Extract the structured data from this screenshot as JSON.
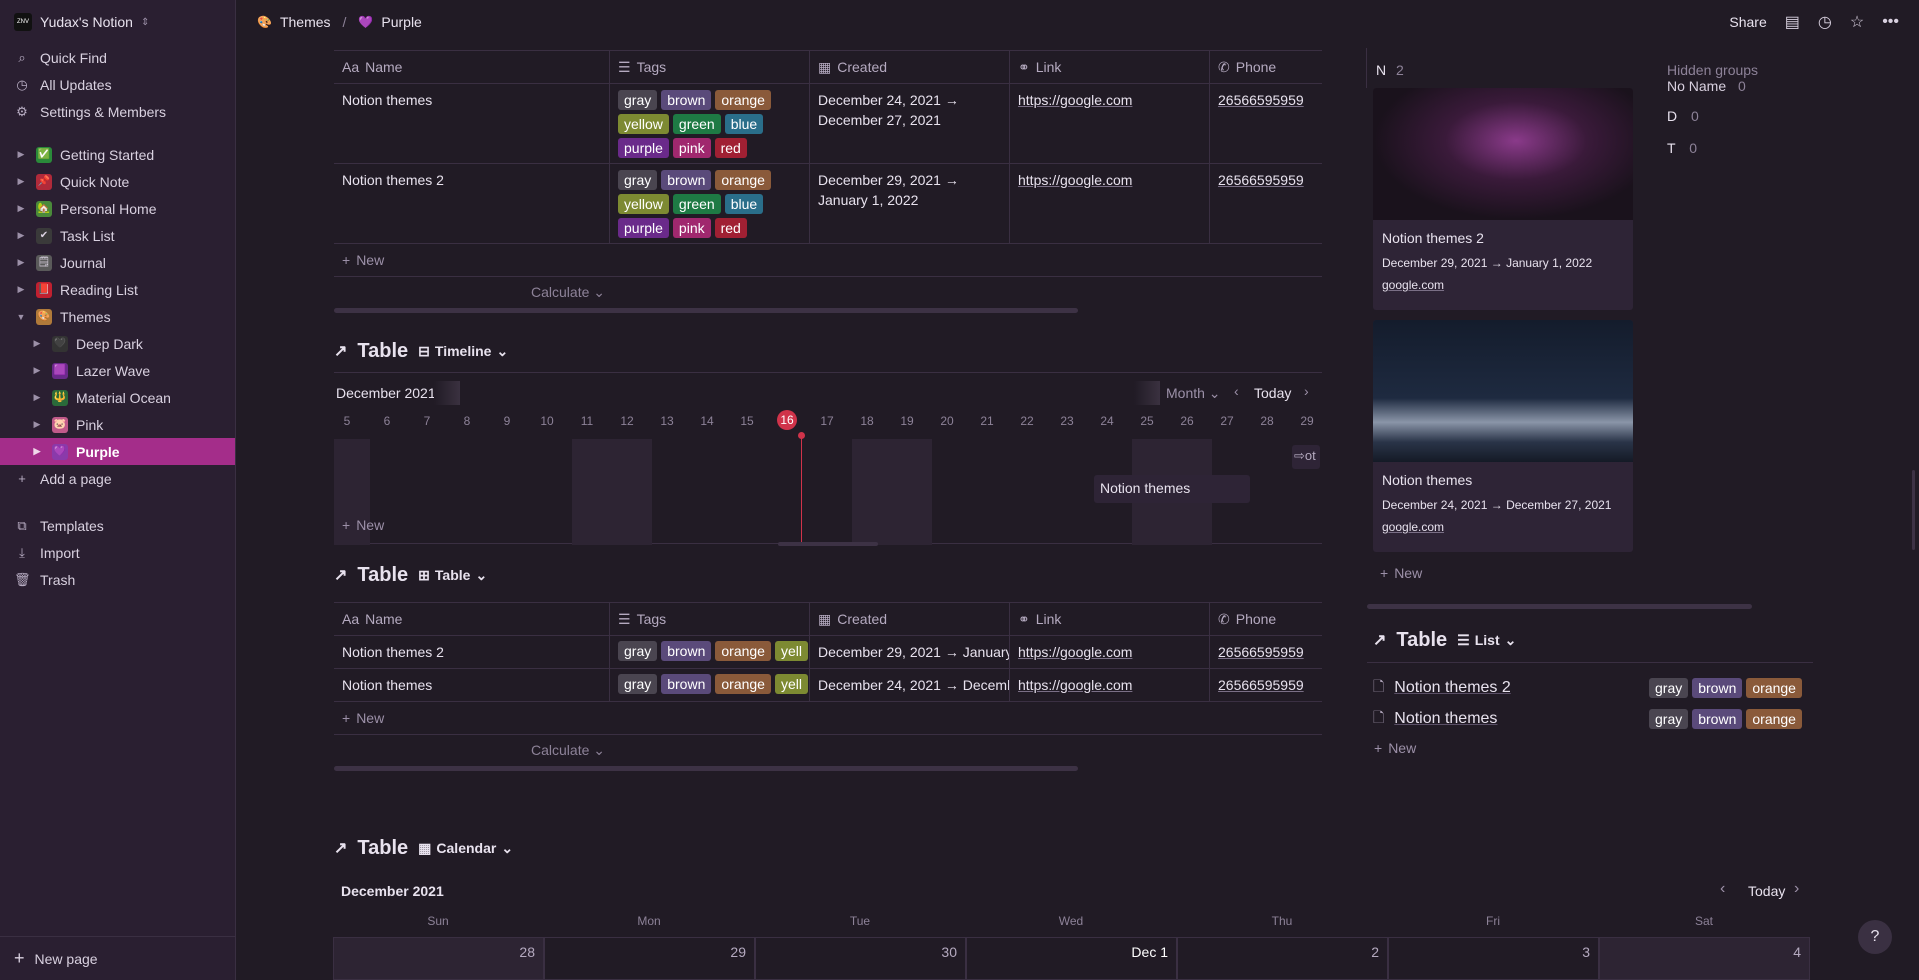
{
  "workspace": {
    "name": "Yudax's Notion",
    "logo": "ZNV"
  },
  "nav": {
    "quick_find": "Quick Find",
    "updates": "All Updates",
    "settings": "Settings & Members"
  },
  "pages": [
    {
      "label": "Getting Started",
      "icon": "✅",
      "color": "#2a8a3a"
    },
    {
      "label": "Quick Note",
      "icon": "📌",
      "color": "#b02a3a"
    },
    {
      "label": "Personal Home",
      "icon": "🏡",
      "color": "#4a8a3a"
    },
    {
      "label": "Task List",
      "icon": "✔",
      "color": "#3a3a3a"
    },
    {
      "label": "Journal",
      "icon": "🗒",
      "color": "#5a5a5a"
    },
    {
      "label": "Reading List",
      "icon": "📕",
      "color": "#c02030"
    },
    {
      "label": "Themes",
      "icon": "🎨",
      "color": "#b07a3a"
    }
  ],
  "subpages": [
    {
      "label": "Deep Dark",
      "icon": "🖤",
      "color": "#333"
    },
    {
      "label": "Lazer Wave",
      "icon": "🟪",
      "color": "#6a2a8a"
    },
    {
      "label": "Material Ocean",
      "icon": "🔱",
      "color": "#2a6a3a"
    },
    {
      "label": "Pink",
      "icon": "🐷",
      "color": "#c05a8a"
    },
    {
      "label": "Purple",
      "icon": "💜",
      "color": "#8a3aaa"
    }
  ],
  "add_page": "Add a page",
  "templates": "Templates",
  "import": "Import",
  "trash": "Trash",
  "new_page": "New page",
  "breadcrumb": {
    "parent": "Themes",
    "current": "Purple",
    "sep": "/"
  },
  "share": "Share",
  "cols": {
    "name": "Name",
    "tags": "Tags",
    "created": "Created",
    "link": "Link",
    "phone": "Phone"
  },
  "table1": [
    {
      "name": "Notion themes",
      "created1": "December 24, 2021 →",
      "created2": "December 27, 2021",
      "link": "https://google.com",
      "phone": "26566595959"
    },
    {
      "name": "Notion themes 2",
      "created1": "December 29, 2021 →",
      "created2": "January 1, 2022",
      "link": "https://google.com",
      "phone": "26566595959"
    }
  ],
  "tags": [
    "gray",
    "brown",
    "orange",
    "yellow",
    "green",
    "blue",
    "purple",
    "pink",
    "red"
  ],
  "new": "New",
  "calculate": "Calculate",
  "view_title": "Table",
  "timeline": {
    "view": "Timeline",
    "month_label": "December 2021",
    "scale": "Month",
    "today": "Today",
    "days": [
      "5",
      "6",
      "7",
      "8",
      "9",
      "10",
      "11",
      "12",
      "13",
      "14",
      "15",
      "16",
      "17",
      "18",
      "19",
      "20",
      "21",
      "22",
      "23",
      "24",
      "25",
      "26",
      "27",
      "28",
      "29"
    ],
    "today_day": "16",
    "bar": "Notion themes",
    "edge": "ot"
  },
  "table2": {
    "view": "Table",
    "rows": [
      {
        "name": "Notion themes 2",
        "created": "December 29, 2021 → January",
        "link": "https://google.com",
        "phone": "26566595959"
      },
      {
        "name": "Notion themes",
        "created": "December 24, 2021 → Decemb",
        "link": "https://google.com",
        "phone": "26566595959"
      }
    ],
    "tag_last": "yell"
  },
  "calendar": {
    "view": "Calendar",
    "month": "December 2021",
    "today": "Today",
    "weekdays": [
      "Sun",
      "Mon",
      "Tue",
      "Wed",
      "Thu",
      "Fri",
      "Sat"
    ],
    "dates": [
      "28",
      "29",
      "30",
      "Dec 1",
      "2",
      "3",
      "4"
    ]
  },
  "board": {
    "group": "N",
    "group_count": "2",
    "hidden": "Hidden groups",
    "hidden_items": [
      {
        "k": "No Name",
        "v": "0"
      },
      {
        "k": "D",
        "v": "0"
      },
      {
        "k": "T",
        "v": "0"
      }
    ],
    "cards": [
      {
        "title": "Notion themes 2",
        "date": "December 29, 2021 → January 1, 2022",
        "link": "google.com"
      },
      {
        "title": "Notion themes",
        "date": "December 24, 2021 → December 27, 2021",
        "link": "google.com"
      }
    ]
  },
  "list": {
    "view": "List",
    "items": [
      "Notion themes 2",
      "Notion themes"
    ],
    "tags": [
      "gray",
      "brown",
      "orange"
    ]
  }
}
